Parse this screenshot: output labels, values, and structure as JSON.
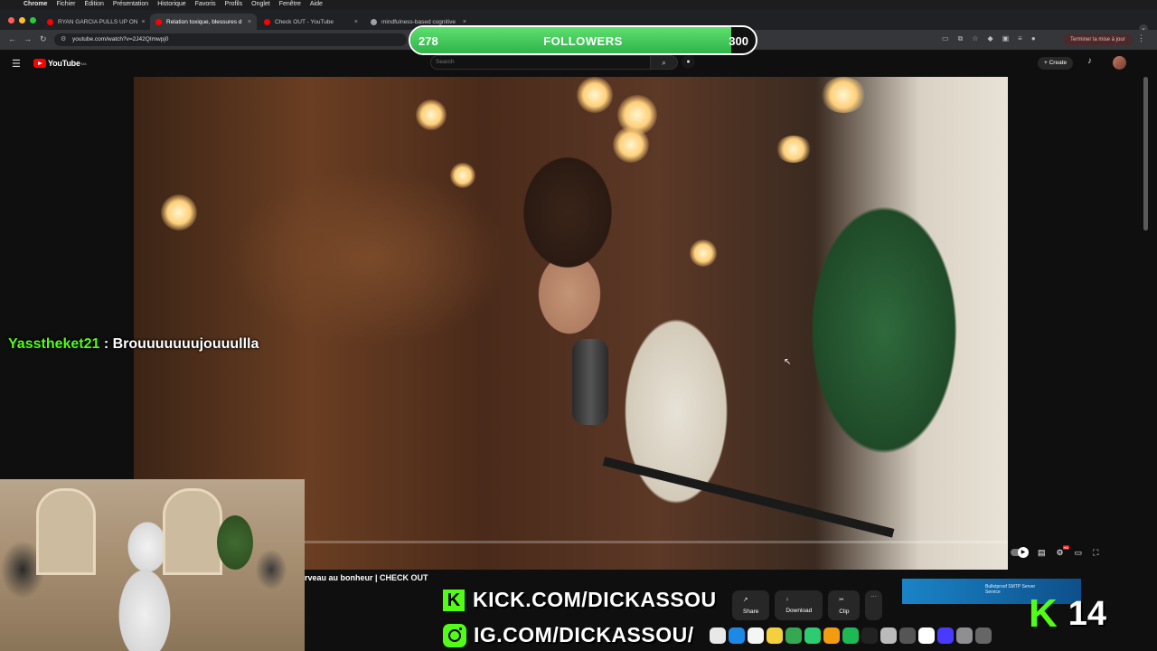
{
  "mac_menubar": {
    "items": [
      "Chrome",
      "Fichier",
      "Édition",
      "Présentation",
      "Historique",
      "Favoris",
      "Profils",
      "Onglet",
      "Fenêtre",
      "Aide"
    ]
  },
  "browser": {
    "tabs": [
      {
        "title": "RYAN GARCIA PULLS UP ON",
        "favicon_color": "#ff0000",
        "active": false
      },
      {
        "title": "Relation toxique, blessures d",
        "favicon_color": "#ff0000",
        "active": true
      },
      {
        "title": "Check OUT - YouTube",
        "favicon_color": "#ff0000",
        "active": false
      },
      {
        "title": "mindfulness-based cognitive",
        "favicon_color": "#9aa0a6",
        "active": false
      }
    ],
    "new_tab_label": "+",
    "url": "youtube.com/watch?v=2J42QImwpj0",
    "update_button": "Terminer la mise à jour"
  },
  "youtube": {
    "logo_text": "YouTube",
    "logo_region": "MA",
    "search_placeholder": "Search",
    "create_label": "Create",
    "video_title": "rveau au bonheur | CHECK OUT",
    "progress_fraction": 0.01,
    "actions": {
      "share": "Share",
      "download": "Download",
      "clip": "Clip",
      "more": "···"
    },
    "ad_text": "Bulletproof SMTP Server Service"
  },
  "overlay": {
    "followers": {
      "current": "278",
      "label": "FOLLOWERS",
      "goal": "300",
      "fill_fraction": 0.93
    },
    "chat": {
      "username": "Yasstheket21",
      "separator": " : ",
      "message": "Brouuuuuuujouuullla"
    },
    "kick_url": "KICK.COM/DICKASSOU",
    "instagram_url": "IG.COM/DICKASSOU/",
    "viewer_count": "14"
  },
  "colors": {
    "kick_green": "#53fc18",
    "followers_green": "#3bc552",
    "youtube_red": "#ff0000"
  }
}
